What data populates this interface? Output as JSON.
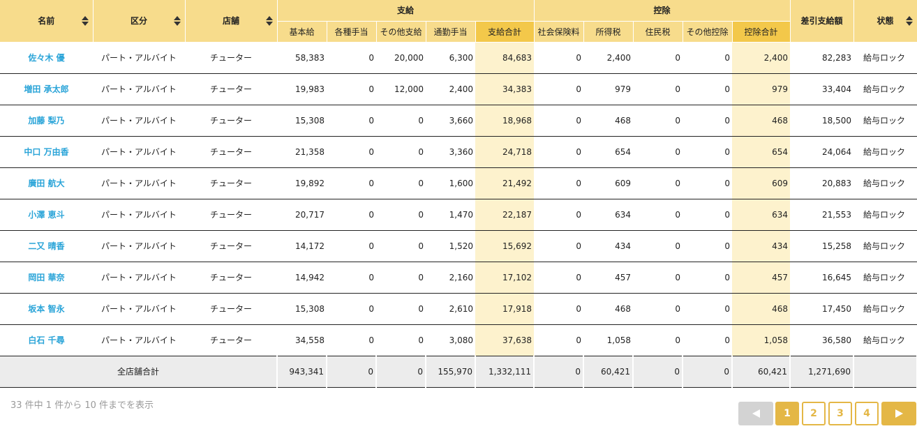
{
  "headers": {
    "name": "名前",
    "kubun": "区分",
    "shop": "店舗",
    "shikyu_group": "支給",
    "kojo_group": "控除",
    "sashihiki": "差引支給額",
    "status": "状態",
    "kihonkyu": "基本給",
    "kakushu_teate": "各種手当",
    "sonota_shikyu": "その他支給",
    "tsukin_teate": "通勤手当",
    "shikyu_gokei": "支給合計",
    "shakai_hoken": "社会保険料",
    "shotokuzei": "所得税",
    "juminzei": "住民税",
    "sonota_kojo": "その他控除",
    "kojo_gokei": "控除合計"
  },
  "rows": [
    {
      "name": "佐々木 優",
      "kubun": "パート・アルバイト",
      "shop": "チューター",
      "kihonkyu": "58,383",
      "kakushu_teate": "0",
      "sonota_shikyu": "20,000",
      "tsukin_teate": "6,300",
      "shikyu_gokei": "84,683",
      "shakai_hoken": "0",
      "shotokuzei": "2,400",
      "juminzei": "0",
      "sonota_kojo": "0",
      "kojo_gokei": "2,400",
      "sashihiki": "82,283",
      "status": "給与ロック"
    },
    {
      "name": "増田 承太郎",
      "kubun": "パート・アルバイト",
      "shop": "チューター",
      "kihonkyu": "19,983",
      "kakushu_teate": "0",
      "sonota_shikyu": "12,000",
      "tsukin_teate": "2,400",
      "shikyu_gokei": "34,383",
      "shakai_hoken": "0",
      "shotokuzei": "979",
      "juminzei": "0",
      "sonota_kojo": "0",
      "kojo_gokei": "979",
      "sashihiki": "33,404",
      "status": "給与ロック"
    },
    {
      "name": "加藤 梨乃",
      "kubun": "パート・アルバイト",
      "shop": "チューター",
      "kihonkyu": "15,308",
      "kakushu_teate": "0",
      "sonota_shikyu": "0",
      "tsukin_teate": "3,660",
      "shikyu_gokei": "18,968",
      "shakai_hoken": "0",
      "shotokuzei": "468",
      "juminzei": "0",
      "sonota_kojo": "0",
      "kojo_gokei": "468",
      "sashihiki": "18,500",
      "status": "給与ロック"
    },
    {
      "name": "中口 万由香",
      "kubun": "パート・アルバイト",
      "shop": "チューター",
      "kihonkyu": "21,358",
      "kakushu_teate": "0",
      "sonota_shikyu": "0",
      "tsukin_teate": "3,360",
      "shikyu_gokei": "24,718",
      "shakai_hoken": "0",
      "shotokuzei": "654",
      "juminzei": "0",
      "sonota_kojo": "0",
      "kojo_gokei": "654",
      "sashihiki": "24,064",
      "status": "給与ロック"
    },
    {
      "name": "廣田 航大",
      "kubun": "パート・アルバイト",
      "shop": "チューター",
      "kihonkyu": "19,892",
      "kakushu_teate": "0",
      "sonota_shikyu": "0",
      "tsukin_teate": "1,600",
      "shikyu_gokei": "21,492",
      "shakai_hoken": "0",
      "shotokuzei": "609",
      "juminzei": "0",
      "sonota_kojo": "0",
      "kojo_gokei": "609",
      "sashihiki": "20,883",
      "status": "給与ロック"
    },
    {
      "name": "小澤 恵斗",
      "kubun": "パート・アルバイト",
      "shop": "チューター",
      "kihonkyu": "20,717",
      "kakushu_teate": "0",
      "sonota_shikyu": "0",
      "tsukin_teate": "1,470",
      "shikyu_gokei": "22,187",
      "shakai_hoken": "0",
      "shotokuzei": "634",
      "juminzei": "0",
      "sonota_kojo": "0",
      "kojo_gokei": "634",
      "sashihiki": "21,553",
      "status": "給与ロック"
    },
    {
      "name": "二又 晴香",
      "kubun": "パート・アルバイト",
      "shop": "チューター",
      "kihonkyu": "14,172",
      "kakushu_teate": "0",
      "sonota_shikyu": "0",
      "tsukin_teate": "1,520",
      "shikyu_gokei": "15,692",
      "shakai_hoken": "0",
      "shotokuzei": "434",
      "juminzei": "0",
      "sonota_kojo": "0",
      "kojo_gokei": "434",
      "sashihiki": "15,258",
      "status": "給与ロック"
    },
    {
      "name": "岡田 華奈",
      "kubun": "パート・アルバイト",
      "shop": "チューター",
      "kihonkyu": "14,942",
      "kakushu_teate": "0",
      "sonota_shikyu": "0",
      "tsukin_teate": "2,160",
      "shikyu_gokei": "17,102",
      "shakai_hoken": "0",
      "shotokuzei": "457",
      "juminzei": "0",
      "sonota_kojo": "0",
      "kojo_gokei": "457",
      "sashihiki": "16,645",
      "status": "給与ロック"
    },
    {
      "name": "坂本 智永",
      "kubun": "パート・アルバイト",
      "shop": "チューター",
      "kihonkyu": "15,308",
      "kakushu_teate": "0",
      "sonota_shikyu": "0",
      "tsukin_teate": "2,610",
      "shikyu_gokei": "17,918",
      "shakai_hoken": "0",
      "shotokuzei": "468",
      "juminzei": "0",
      "sonota_kojo": "0",
      "kojo_gokei": "468",
      "sashihiki": "17,450",
      "status": "給与ロック"
    },
    {
      "name": "白石 千尋",
      "kubun": "パート・アルバイト",
      "shop": "チューター",
      "kihonkyu": "34,558",
      "kakushu_teate": "0",
      "sonota_shikyu": "0",
      "tsukin_teate": "3,080",
      "shikyu_gokei": "37,638",
      "shakai_hoken": "0",
      "shotokuzei": "1,058",
      "juminzei": "0",
      "sonota_kojo": "0",
      "kojo_gokei": "1,058",
      "sashihiki": "36,580",
      "status": "給与ロック"
    }
  ],
  "totals": {
    "label": "全店舗合計",
    "kihonkyu": "943,341",
    "kakushu_teate": "0",
    "sonota_shikyu": "0",
    "tsukin_teate": "155,970",
    "shikyu_gokei": "1,332,111",
    "shakai_hoken": "0",
    "shotokuzei": "60,421",
    "juminzei": "0",
    "sonota_kojo": "0",
    "kojo_gokei": "60,421",
    "sashihiki": "1,271,690",
    "status": ""
  },
  "footer": {
    "summary": "33 件中 1 件から 10 件までを表示"
  },
  "pagination": {
    "prev_icon": "triangle-left-icon",
    "next_icon": "triangle-right-icon",
    "pages": [
      "1",
      "2",
      "3",
      "4"
    ],
    "active_page": "1"
  },
  "colors": {
    "header_bg": "#f7dc8c",
    "header_highlight": "#f3c84a",
    "name_link": "#2aa4d8",
    "total_highlight_cell": "#fdf2cd",
    "pager_accent": "#e4b746",
    "pager_disabled": "#d3d3d3",
    "totals_bg": "#ececec"
  }
}
